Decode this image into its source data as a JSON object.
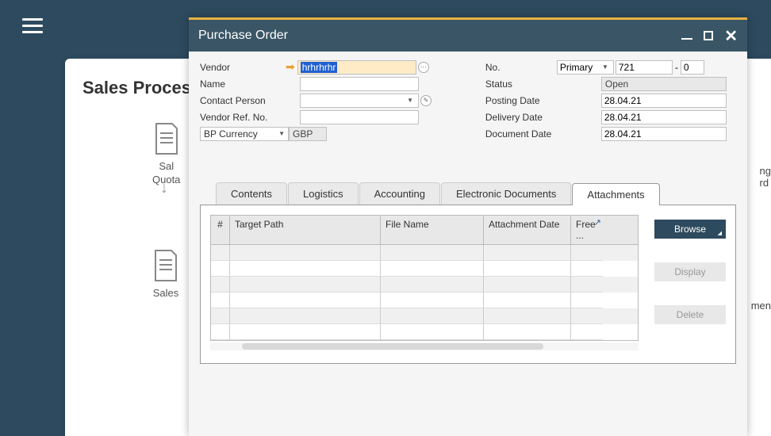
{
  "hamburger": "menu",
  "background": {
    "title": "Sales Process",
    "icon1_line1": "Sal",
    "icon1_line2": "Quota",
    "icon2": "Sales",
    "right_partial1": "ng",
    "right_partial2": "rd",
    "right_partial3": "men"
  },
  "window": {
    "title": "Purchase Order",
    "left": {
      "vendor_label": "Vendor",
      "vendor_value": "hrhrhrhr",
      "name_label": "Name",
      "name_value": "",
      "contact_label": "Contact Person",
      "contact_value": "",
      "ref_label": "Vendor Ref. No.",
      "ref_value": "",
      "currency_label": "BP Currency",
      "currency_value": "GBP"
    },
    "right": {
      "no_label": "No.",
      "no_type": "Primary",
      "no_value": "721",
      "no_suffix": "0",
      "status_label": "Status",
      "status_value": "Open",
      "posting_label": "Posting Date",
      "posting_value": "28.04.21",
      "delivery_label": "Delivery Date",
      "delivery_value": "28.04.21",
      "document_label": "Document Date",
      "document_value": "28.04.21"
    },
    "tabs": {
      "contents": "Contents",
      "logistics": "Logistics",
      "accounting": "Accounting",
      "electronic": "Electronic Documents",
      "attachments": "Attachments"
    },
    "table": {
      "col_num": "#",
      "col_path": "Target Path",
      "col_file": "File Name",
      "col_date": "Attachment Date",
      "col_free": "Free ..."
    },
    "buttons": {
      "browse": "Browse",
      "display": "Display",
      "delete": "Delete"
    }
  }
}
